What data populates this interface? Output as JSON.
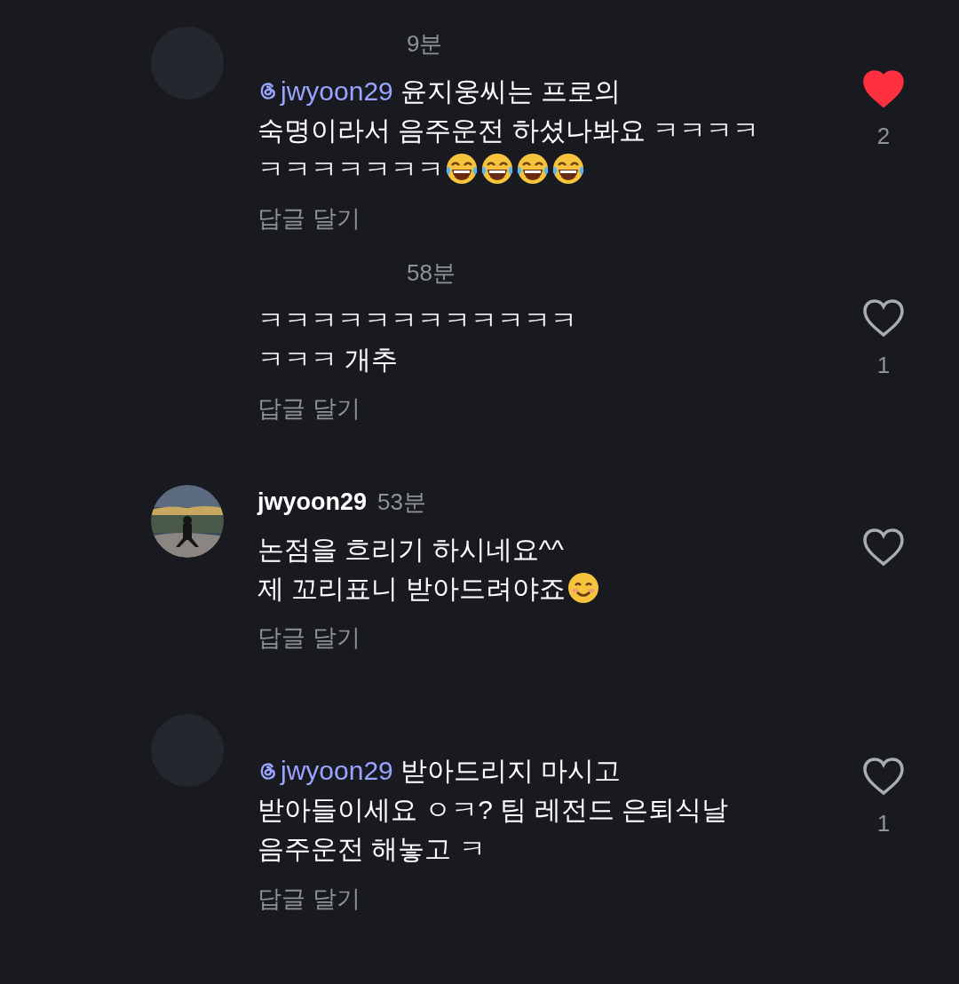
{
  "comments": [
    {
      "avatar": {
        "kind": "plain"
      },
      "time": "9분",
      "lines": [
        [
          {
            "kind": "mention",
            "text": "jwyoon29"
          },
          {
            "kind": "text",
            "text": " 윤지웅씨는 프로의"
          }
        ],
        [
          {
            "kind": "text",
            "text": "숙명이라서 음주운전 하셨나봐요 ㅋㅋㅋㅋ"
          }
        ],
        [
          {
            "kind": "text",
            "text": "ㅋㅋㅋㅋㅋㅋㅋ"
          },
          {
            "kind": "laugh"
          },
          {
            "kind": "laugh"
          },
          {
            "kind": "laugh"
          },
          {
            "kind": "laugh"
          }
        ]
      ],
      "reply": "답글 달기",
      "liked": true,
      "likes": "2"
    },
    {
      "time": "58분",
      "lines": [
        [
          {
            "kind": "text",
            "text": "ㅋㅋㅋㅋㅋㅋㅋㅋㅋㅋㅋㅋ"
          }
        ],
        [
          {
            "kind": "text",
            "text": "ㅋㅋㅋ 개추"
          }
        ]
      ],
      "reply": "답글 달기",
      "liked": false,
      "likes": "1"
    },
    {
      "avatar": {
        "kind": "picture"
      },
      "username": "jwyoon29",
      "time": "53분",
      "lines": [
        [
          {
            "kind": "text",
            "text": "논점을 흐리기 하시네요^^"
          }
        ],
        [
          {
            "kind": "text",
            "text": "제 꼬리표니 받아드려야죠"
          },
          {
            "kind": "smile"
          }
        ]
      ],
      "reply": "답글 달기",
      "liked": false
    },
    {
      "avatar": {
        "kind": "plain"
      },
      "lines": [
        [
          {
            "kind": "mention",
            "text": "jwyoon29"
          },
          {
            "kind": "text",
            "text": " 받아드리지 마시고"
          }
        ],
        [
          {
            "kind": "text",
            "text": "받아들이세요 ㅇㅋ? 팀 레전드 은퇴식날"
          }
        ],
        [
          {
            "kind": "text",
            "text": "음주운전 해놓고 ㅋ"
          }
        ]
      ],
      "reply": "답글 달기",
      "liked": false,
      "likes": "1"
    }
  ]
}
